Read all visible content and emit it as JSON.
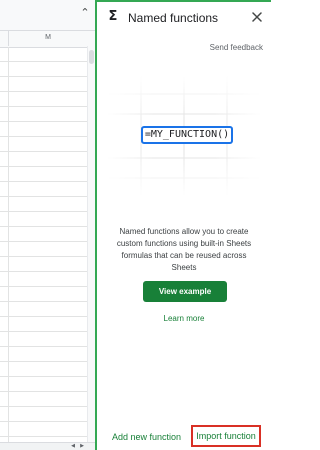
{
  "sheet": {
    "column_label": "M",
    "chevron_icon": "chevron-up-icon"
  },
  "panel": {
    "title": "Named functions",
    "title_icon": "sigma-icon",
    "close_icon": "close-icon",
    "send_feedback": "Send feedback",
    "formula_example": "=MY_FUNCTION()",
    "description": "Named functions allow you to create custom functions using built-in Sheets formulas that can be reused across Sheets",
    "view_example_label": "View example",
    "learn_more_label": "Learn more",
    "add_new_function_label": "Add new function",
    "import_function_label": "Import function"
  },
  "colors": {
    "panel_border": "#34a853",
    "accent_green": "#188038",
    "formula_border": "#1a73e8",
    "import_highlight": "#d93025"
  }
}
